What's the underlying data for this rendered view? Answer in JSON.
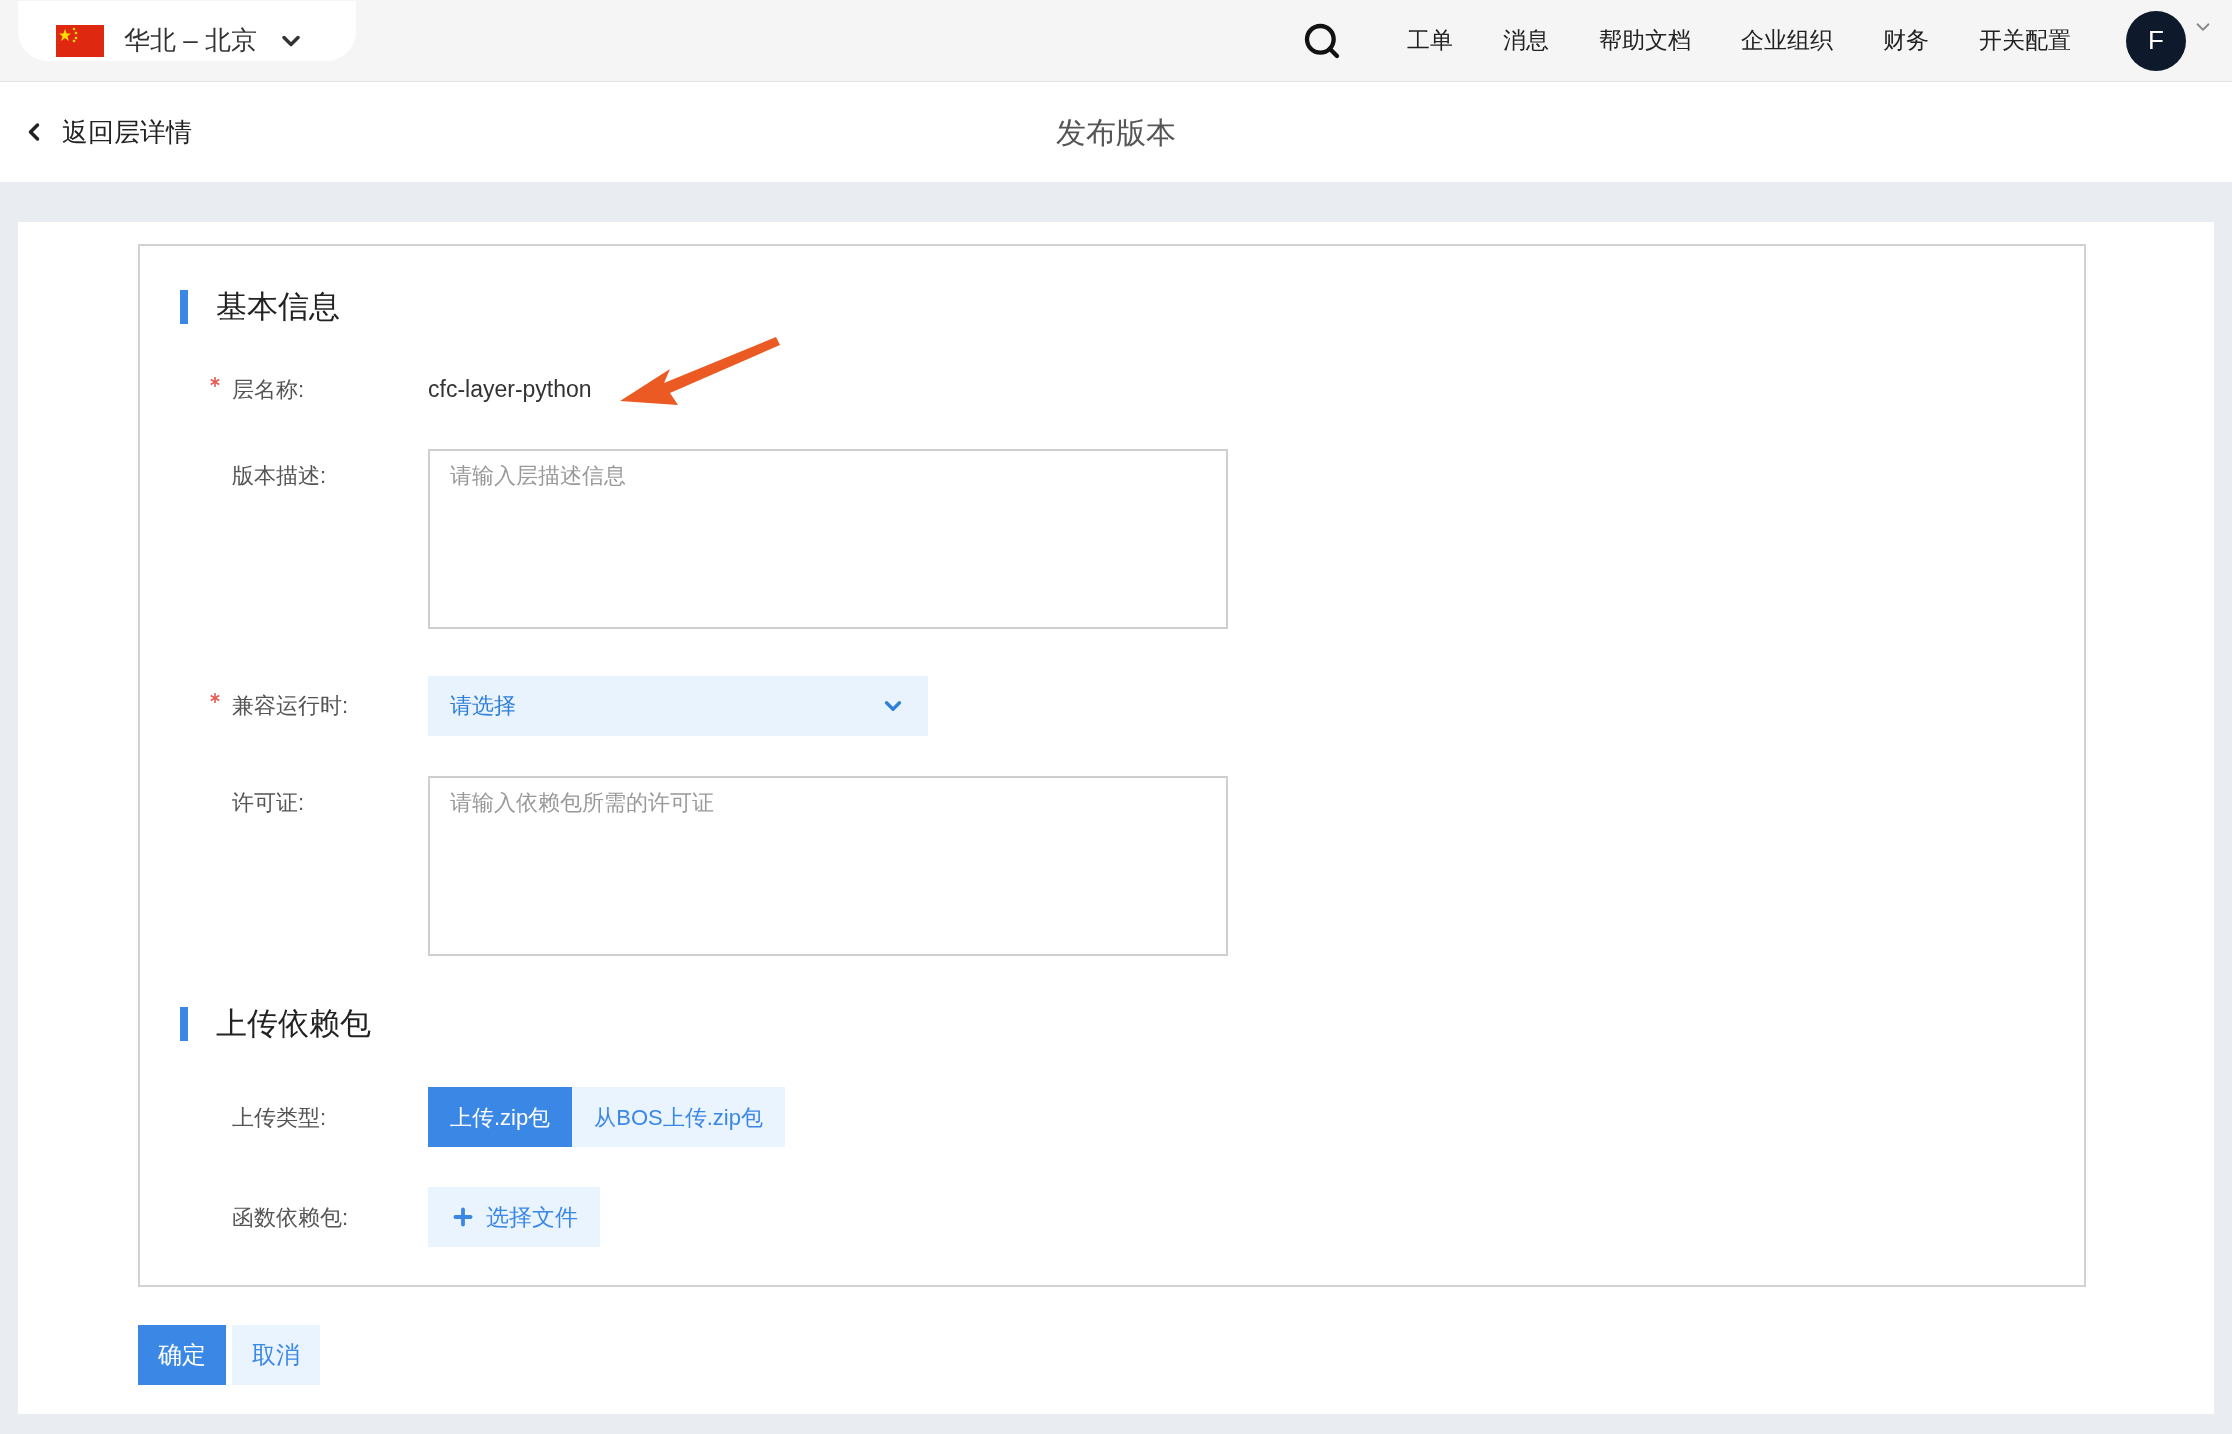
{
  "top_bar": {
    "region": "华北 – 北京",
    "nav_items": [
      "工单",
      "消息",
      "帮助文档",
      "企业组织",
      "财务",
      "开关配置"
    ],
    "avatar": "F"
  },
  "header": {
    "back": "返回层详情",
    "title": "发布版本"
  },
  "sections": [
    {
      "title": "基本信息",
      "fields": [
        {
          "kind": "text",
          "label": "层名称:",
          "required": true,
          "value": "cfc-layer-python"
        },
        {
          "kind": "textarea",
          "label": "版本描述:",
          "required": false,
          "placeholder": "请输入层描述信息"
        },
        {
          "kind": "select",
          "label": "兼容运行时:",
          "required": true,
          "value": "请选择"
        },
        {
          "kind": "textarea",
          "label": "许可证:",
          "required": false,
          "placeholder": "请输入依赖包所需的许可证"
        }
      ]
    },
    {
      "title": "上传依赖包",
      "fields": [
        {
          "kind": "segmented",
          "label": "上传类型:",
          "required": false,
          "options": [
            {
              "label": "上传.zip包",
              "selected": true
            },
            {
              "label": "从BOS上传.zip包",
              "selected": false
            }
          ]
        },
        {
          "kind": "upload",
          "label": "函数依赖包:",
          "required": false,
          "button": "选择文件"
        }
      ]
    }
  ],
  "actions": [
    {
      "label": "确定",
      "primary": true
    },
    {
      "label": "取消",
      "primary": false
    }
  ]
}
